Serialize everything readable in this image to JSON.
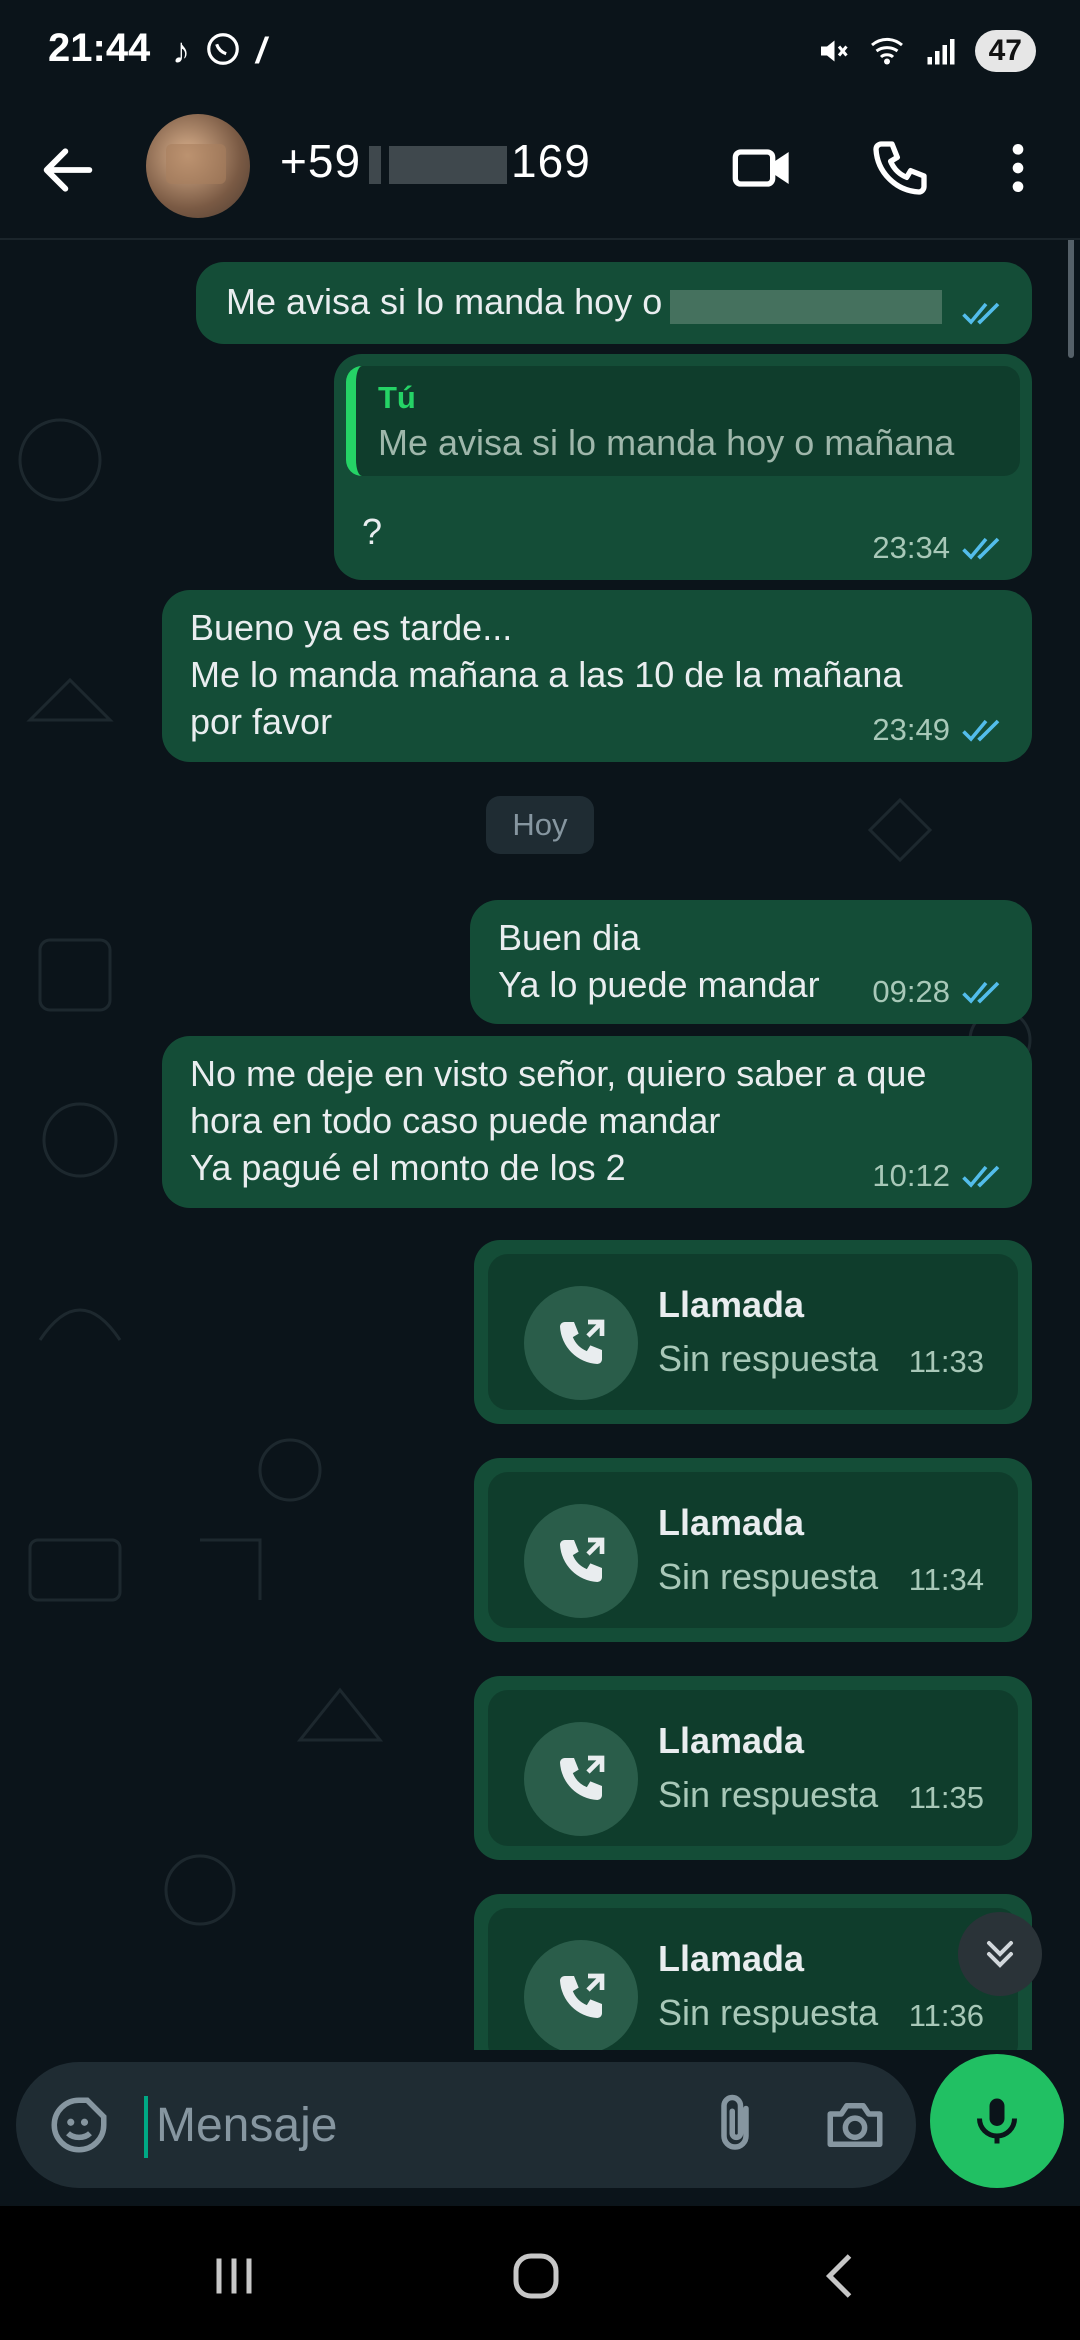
{
  "status": {
    "time": "21:44",
    "app_icons": [
      "tiktok-icon",
      "whatsapp-icon",
      "yape-icon"
    ],
    "battery": "47"
  },
  "header": {
    "contact_prefix": "+59",
    "contact_suffix": "169"
  },
  "messages": [
    {
      "text": "Me avisa si lo manda hoy o mañana",
      "visible_text": "Me avisa si lo manda hoy o",
      "status": "read"
    },
    {
      "quote_author": "Tú",
      "quote_text": "Me avisa si lo manda hoy o mañana",
      "text": "?",
      "time": "23:34",
      "status": "read"
    },
    {
      "text": "Bueno ya es tarde...\nMe lo manda mañana a las 10 de la mañana\npor favor",
      "time": "23:49",
      "status": "read"
    },
    {
      "text": "Buen dia\nYa lo puede mandar",
      "time": "09:28",
      "status": "read"
    },
    {
      "text": "No me deje en visto señor, quiero saber a que\nhora en todo caso puede mandar\nYa pagué el monto de los 2",
      "time": "10:12",
      "status": "read"
    }
  ],
  "date_chip": "Hoy",
  "calls": [
    {
      "title": "Llamada",
      "status": "Sin respuesta",
      "time": "11:33"
    },
    {
      "title": "Llamada",
      "status": "Sin respuesta",
      "time": "11:34"
    },
    {
      "title": "Llamada",
      "status": "Sin respuesta",
      "time": "11:35"
    },
    {
      "title": "Llamada",
      "status": "Sin respuesta",
      "time": "11:36"
    }
  ],
  "input": {
    "placeholder": "Mensaje"
  },
  "colors": {
    "background": "#0b141a",
    "bubble_out": "#144d37",
    "accent": "#25d366",
    "read_check": "#53bdeb"
  }
}
